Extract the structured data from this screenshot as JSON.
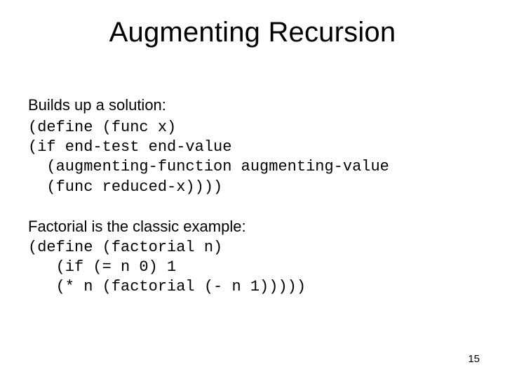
{
  "slide": {
    "title": "Augmenting Recursion",
    "lead1": "Builds up a solution:",
    "code1_l1": "(define (func x)",
    "code1_l2": "(if end-test end-value",
    "code1_l3": "  (augmenting-function augmenting-value",
    "code1_l4": "  (func reduced-x))))",
    "lead2": "Factorial is the classic example:",
    "code2_l1": "(define (factorial n)",
    "code2_l2": "   (if (= n 0) 1",
    "code2_l3": "   (* n (factorial (- n 1)))))",
    "page_number": "15"
  }
}
